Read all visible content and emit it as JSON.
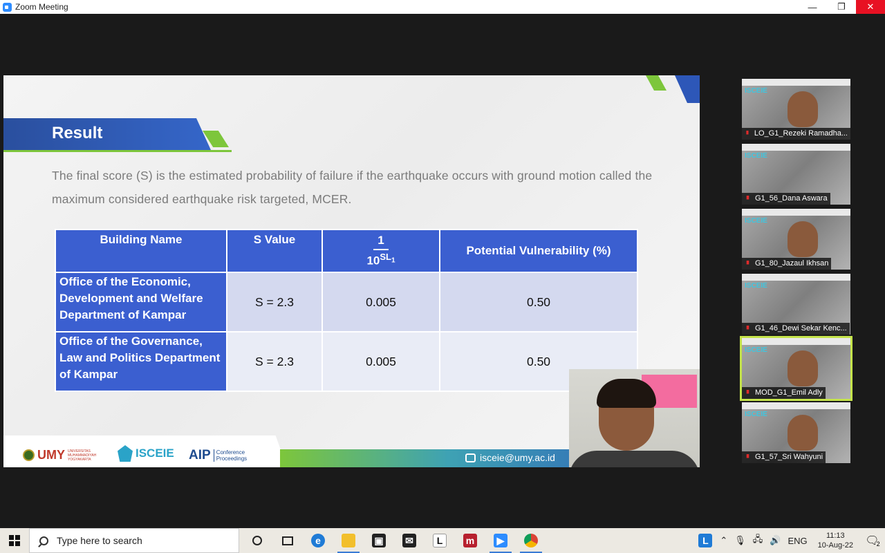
{
  "window": {
    "title": "Zoom Meeting",
    "minimize": "—",
    "restore": "❐",
    "close": "✕"
  },
  "slide": {
    "heading": "Result",
    "paragraph": "The final score (S) is the estimated probability of failure if the earthquake occurs with ground motion called the maximum considered earthquake risk targeted, MCER.",
    "table": {
      "headers": {
        "building": "Building Name",
        "s_value": "S Value",
        "frac_num": "1",
        "frac_base": "10",
        "frac_exp": "SL",
        "frac_sub": "1",
        "vulnerability": "Potential Vulnerability (%)"
      },
      "rows": [
        {
          "name": "Office of the Economic, Development and Welfare Department of Kampar",
          "s": "S = 2.3",
          "frac": "0.005",
          "vuln": "0.50"
        },
        {
          "name": "Office of the Governance, Law and Politics Department of Kampar",
          "s": "S = 2.3",
          "frac": "0.005",
          "vuln": "0.50"
        }
      ]
    },
    "footer": {
      "umy": "UMY",
      "umy_small": "UNIVERSITAS MUHAMMADIYAH YOGYAKARTA",
      "isceie": "ISCEIE",
      "aip": "AIP",
      "aip_sub": "Conference Proceedings",
      "email": "isceie@umy.ac.id"
    }
  },
  "participants": [
    {
      "name": "LO_G1_Rezeki Ramadha..."
    },
    {
      "name": "G1_56_Dana Aswara"
    },
    {
      "name": "G1_80_Jazaul Ikhsan"
    },
    {
      "name": "G1_46_Dewi Sekar Kenc..."
    },
    {
      "name": "MOD_G1_Emil Adly"
    },
    {
      "name": "G1_57_Sri Wahyuni"
    }
  ],
  "taskbar": {
    "search_placeholder": "Type here to search",
    "tray": {
      "lang": "ENG",
      "time": "11:13",
      "date": "10-Aug-22",
      "notif_count": "2"
    }
  }
}
